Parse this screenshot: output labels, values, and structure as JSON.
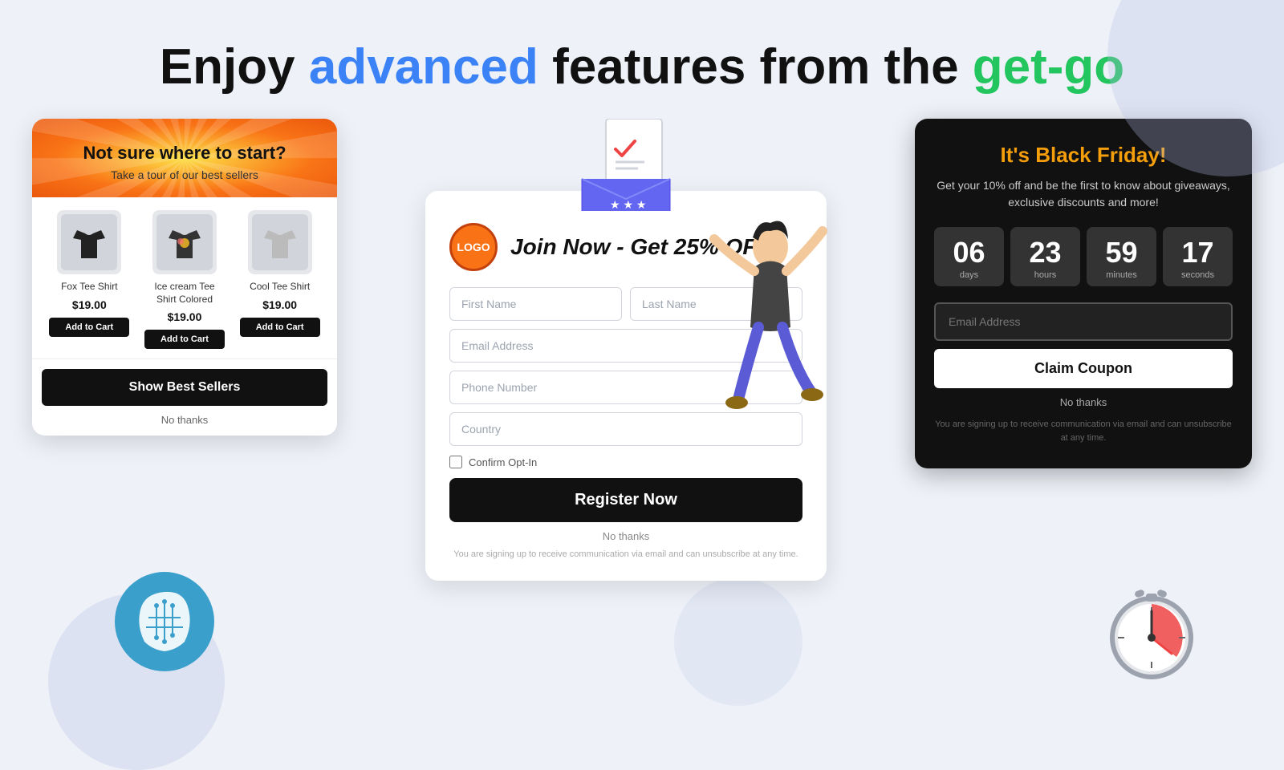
{
  "header": {
    "prefix": "Enjoy ",
    "blue_word": "advanced",
    "middle": " features from the ",
    "green_word": "get-go"
  },
  "bestsellers_card": {
    "title": "Not sure where to start?",
    "subtitle": "Take a tour of our best sellers",
    "products": [
      {
        "name": "Fox Tee Shirt",
        "price": "$19.00",
        "add_label": "Add to Cart",
        "emoji": "👕"
      },
      {
        "name": "Ice cream Tee Shirt Colored",
        "price": "$19.00",
        "add_label": "Add to Cart",
        "emoji": "👕"
      },
      {
        "name": "Cool Tee Shirt",
        "price": "$19.00",
        "add_label": "Add to Cart",
        "emoji": "👕"
      }
    ],
    "show_btn_label": "Show Best Sellers",
    "no_thanks_label": "No thanks"
  },
  "register_card": {
    "logo_text": "LOGO",
    "title": "Join Now - Get 25% OFF",
    "fields": {
      "first_name_placeholder": "First Name",
      "last_name_placeholder": "Last Name",
      "email_placeholder": "Email Address",
      "phone_placeholder": "Phone Number",
      "country_placeholder": "Country"
    },
    "checkbox_label": "Confirm Opt-In",
    "register_btn_label": "Register Now",
    "no_thanks_label": "No thanks",
    "fine_print": "You are signing up to receive communication via email and can unsubscribe at any time."
  },
  "blackfriday_card": {
    "title": "It's Black Friday!",
    "subtitle": "Get your 10% off and be the first to know about giveaways, exclusive discounts and more!",
    "countdown": {
      "days": {
        "value": "06",
        "label": "days"
      },
      "hours": {
        "value": "23",
        "label": "hours"
      },
      "minutes": {
        "value": "59",
        "label": "minutes"
      },
      "seconds": {
        "value": "17",
        "label": "seconds"
      }
    },
    "email_placeholder": "Email Address",
    "claim_btn_label": "Claim Coupon",
    "no_thanks_label": "No thanks",
    "fine_print": "You are signing up to receive communication via email and can unsubscribe at any time."
  }
}
